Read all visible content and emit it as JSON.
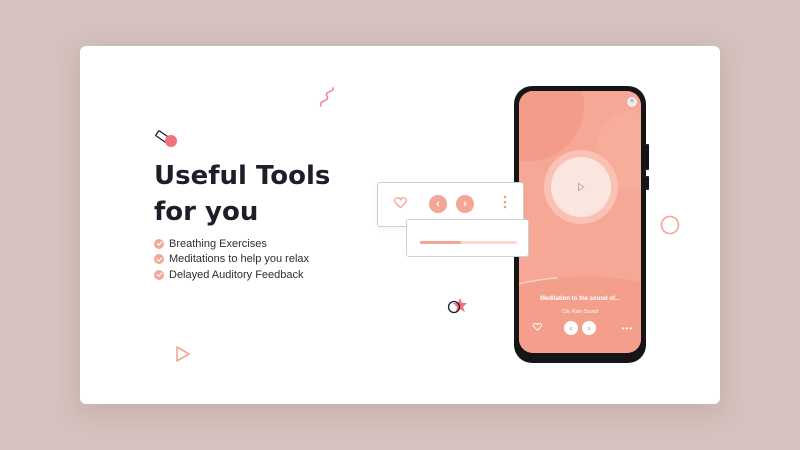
{
  "hero": {
    "title_line1": "Useful Tools",
    "title_line2": "for you"
  },
  "features": [
    {
      "label": "Breathing Exercises",
      "icon": "check-icon"
    },
    {
      "label": "Meditations to help you relax",
      "icon": "check-icon"
    },
    {
      "label": "Delayed Auditory Feedback",
      "icon": "check-icon"
    }
  ],
  "phone": {
    "track_title": "Meditation to the sound of...",
    "track_subtitle": "City Rain Sound",
    "prev_glyph": "‹",
    "next_glyph": "›",
    "close_glyph": "×",
    "more_glyph": "•••"
  },
  "player_card": {
    "prev_glyph": "‹",
    "next_glyph": "›",
    "more_glyph": "•\n•\n•",
    "progress": 0.42
  },
  "colors": {
    "background": "#d5c1bd",
    "card": "#ffffff",
    "accent": "#f4a595",
    "screen": "#f7a795",
    "title": "#1e1e2a"
  }
}
